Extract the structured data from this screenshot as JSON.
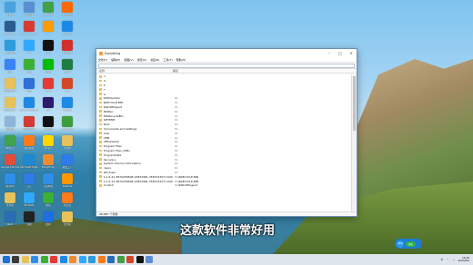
{
  "desktop_icons": [
    {
      "label": "此电脑",
      "color": "#4aa3df"
    },
    {
      "label": "Autodesk...",
      "color": "#2a5c8f"
    },
    {
      "label": "QQ浏览器",
      "color": "#2d9cdb"
    },
    {
      "label": "迅雷",
      "color": "#3b82f6"
    },
    {
      "label": "新建文件夹",
      "color": "#e7c15c"
    },
    {
      "label": "新建文件夹",
      "color": "#e7c15c"
    },
    {
      "label": "回收站",
      "color": "#8fb5d9"
    },
    {
      "label": "360安全",
      "color": "#3fa34d"
    },
    {
      "label": "Google Chrome",
      "color": "#e44d3a"
    },
    {
      "label": "腾讯QQ",
      "color": "#2f8fe8"
    },
    {
      "label": "文件夹",
      "color": "#e7c15c"
    },
    {
      "label": "Word",
      "color": "#2b6cb6"
    },
    {
      "label": "控制面板",
      "color": "#5b8fd1"
    },
    {
      "label": "Adobe Acrobat",
      "color": "#d73a2f"
    },
    {
      "label": "PS",
      "color": "#31a8ff"
    },
    {
      "label": "微信",
      "color": "#3cb034"
    },
    {
      "label": "迅雷",
      "color": "#2f6fd6"
    },
    {
      "label": "Internet Explorer",
      "color": "#1e88e5"
    },
    {
      "label": "网易云音乐",
      "color": "#d33a31"
    },
    {
      "label": "腾讯视频",
      "color": "#ff7a1a"
    },
    {
      "label": "Microsoft Edge",
      "color": "#1f8ad2"
    },
    {
      "label": "钉钉",
      "color": "#2f7be8"
    },
    {
      "label": "PS 2020",
      "color": "#31a8ff"
    },
    {
      "label": "剪映",
      "color": "#222222"
    },
    {
      "label": "360杀毒",
      "color": "#43a047"
    },
    {
      "label": "Ai",
      "color": "#ff9a00"
    },
    {
      "label": "抖音",
      "color": "#111111"
    },
    {
      "label": "爱奇艺",
      "color": "#00be06"
    },
    {
      "label": "WPS",
      "color": "#e53935"
    },
    {
      "label": "PR",
      "color": "#2b1a6f"
    },
    {
      "label": "CapCut",
      "color": "#111111"
    },
    {
      "label": "QQ音乐",
      "color": "#ffd600"
    },
    {
      "label": "Everything",
      "color": "#f08c2e"
    },
    {
      "label": "百度网盘",
      "color": "#2f8fe8"
    },
    {
      "label": "微信",
      "color": "#3cb034"
    },
    {
      "label": "酷狗",
      "color": "#1f6fe0"
    },
    {
      "label": "阿里旺旺",
      "color": "#ff6a00"
    },
    {
      "label": "Foxmail",
      "color": "#1e88e5"
    },
    {
      "label": "网易邮箱",
      "color": "#d32f2f"
    },
    {
      "label": "Excel",
      "color": "#1e7d45"
    },
    {
      "label": "PPT",
      "color": "#d24726"
    },
    {
      "label": "ToDesk",
      "color": "#1e88e5"
    },
    {
      "label": "Camtasia",
      "color": "#3c9d3c"
    },
    {
      "label": "文件夹",
      "color": "#e7c15c"
    },
    {
      "label": "格式工厂",
      "color": "#2f7be8"
    },
    {
      "label": "Sublime",
      "color": "#ff9800"
    },
    {
      "label": "向日葵",
      "color": "#ff7a1a"
    },
    {
      "label": "文件夹",
      "color": "#e7c15c"
    }
  ],
  "window": {
    "title": "Everything",
    "menu": [
      "文件(F)",
      "编辑(E)",
      "视图(V)",
      "搜索(S)",
      "书签(B)",
      "工具(T)",
      "帮助(H)"
    ],
    "search_value": "",
    "columns": {
      "name": "名称",
      "path": "路径"
    },
    "rows": [
      {
        "name": "C:",
        "path": ""
      },
      {
        "name": "D:",
        "path": ""
      },
      {
        "name": "E:",
        "path": ""
      },
      {
        "name": "F:",
        "path": ""
      },
      {
        "name": "G:",
        "path": ""
      },
      {
        "name": "$360Section",
        "path": "C:"
      },
      {
        "name": "$RECYCLE.BIN",
        "path": "C:"
      },
      {
        "name": "$WinREAgent",
        "path": "C:"
      },
      {
        "name": "360Rec",
        "path": "C:"
      },
      {
        "name": "360RecycleBin",
        "path": "C:"
      },
      {
        "name": "AMTEMP",
        "path": "C:"
      },
      {
        "name": "Boot",
        "path": "C:"
      },
      {
        "name": "Documents and Settings",
        "path": "C:"
      },
      {
        "name": "Intel",
        "path": "C:"
      },
      {
        "name": "OEM",
        "path": "C:"
      },
      {
        "name": "OfficeSetup",
        "path": "C:"
      },
      {
        "name": "Program Files",
        "path": "C:"
      },
      {
        "name": "Program Files (x86)",
        "path": "C:"
      },
      {
        "name": "ProgramData",
        "path": "C:"
      },
      {
        "name": "Recovery",
        "path": "C:"
      },
      {
        "name": "System Volume Information",
        "path": "C:"
      },
      {
        "name": "Users",
        "path": "C:"
      },
      {
        "name": "Windows",
        "path": "C:"
      },
      {
        "name": "S-1-5-21-3870258508-15823981-3587232571-500",
        "path": "C:\\$RECYCLE.BIN"
      },
      {
        "name": "S-1-5-21-3870258508-15823981-3587232571-500",
        "path": "C:\\$RECYCLE.BIN"
      },
      {
        "name": "Scratch",
        "path": "C:\\$WinREAgent"
      }
    ],
    "status": "28,987 个对象"
  },
  "subtitle": "这款软件非常好用",
  "widget": {
    "temp": "26%",
    "badge": "省电"
  },
  "taskbar": {
    "icons": [
      "#1f6fd6",
      "#3a3a3a",
      "#e7c15c",
      "#2f8fe8",
      "#3cb034",
      "#e53935",
      "#1e88e5",
      "#f08c2e",
      "#31a8ff",
      "#2d9cdb",
      "#ff7a1a",
      "#2b6cb6",
      "#43a047",
      "#d24726",
      "#111111",
      "#5b8fd1"
    ],
    "tray_lang": "中",
    "time": "16:29",
    "date": "2023/6/6"
  }
}
